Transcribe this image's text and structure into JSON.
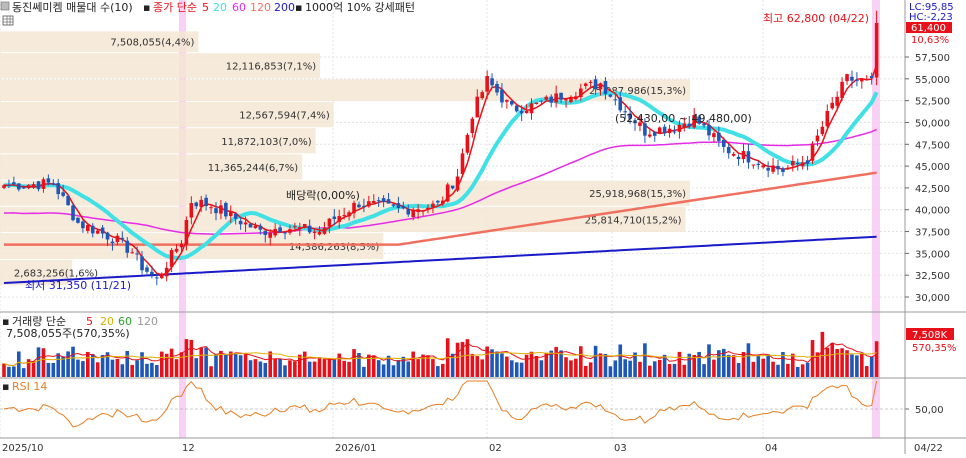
{
  "colors": {
    "up": "#e8111a",
    "down": "#1d58b8",
    "ma5": "#e8111a",
    "ma20": "#3fe0e6",
    "ma60": "#e62ce6",
    "ma120": "#f07060",
    "ma200": "#1a1ac8",
    "vol_ma5": "#e8111a",
    "vol_ma20": "#e0b000",
    "vol_ma60": "#2aa02a",
    "vol_ma120": "#999999",
    "volume_profile": "#f5e6d3",
    "highlight": "#f7c6f2",
    "rsi": "#e67e22"
  },
  "header": {
    "stock_name": "동진쎄미켐 매물대 수(10)",
    "ma_label": "종가 단순",
    "ma_periods": [
      "5",
      "20",
      "60",
      "120",
      "200"
    ],
    "extra": "1000억 10% 강세패턴"
  },
  "volume_header": {
    "label": "거래량 단순",
    "ma_periods": [
      "5",
      "20",
      "60",
      "120"
    ],
    "current": "7,508,055주(570,35%)"
  },
  "rsi_header": {
    "label": "RSI 14"
  },
  "right_labels": {
    "lc": "LC:95,85",
    "hc": "HC:-2,23",
    "last_price": "61,400",
    "change_pct": "10,63%",
    "last_volume": "7,508K",
    "volume_pct": "570,35%"
  },
  "annotations": {
    "high": "최고 62,800 (04/22)",
    "low": "최저 31,350 (11/21)",
    "dividend": "배당락(0,00%)",
    "range": "(52,430,00 ~ 49,480,00)"
  },
  "chart_data": {
    "type": "candlestick",
    "y_ticks": [
      "57,500",
      "55,000",
      "52,500",
      "50,000",
      "47,500",
      "45,000",
      "42,500",
      "40,000",
      "37,500",
      "35,000",
      "32,500",
      "30,000"
    ],
    "x_ticks": [
      "2025/10",
      "12",
      "2026/01",
      "02",
      "03",
      "04",
      "04/22"
    ],
    "rsi_ticks": [
      "50,00"
    ],
    "volume_profile": [
      {
        "label": "7,508,055(4,4%)",
        "low": 58000,
        "high": 60500
      },
      {
        "label": "12,116,853(7,1%)",
        "low": 55000,
        "high": 58000
      },
      {
        "label": "25,987,986(15,3%)",
        "low": 52400,
        "high": 55000
      },
      {
        "label": "12,567,594(7,4%)",
        "low": 49400,
        "high": 52400
      },
      {
        "label": "11,872,103(7,0%)",
        "low": 46400,
        "high": 49400
      },
      {
        "label": "11,365,244(6,7%)",
        "low": 43400,
        "high": 46400
      },
      {
        "label": "25,918,968(15,3%)",
        "low": 40400,
        "high": 43400
      },
      {
        "label": "25,814,710(15,2%)",
        "low": 37400,
        "high": 40400
      },
      {
        "label": "14,386,263(8,5%)",
        "low": 34300,
        "high": 37400
      },
      {
        "label": "2,683,256(1,6%)",
        "low": 31300,
        "high": 34300
      }
    ],
    "anchors": [
      [
        0,
        42800
      ],
      [
        10,
        43000
      ],
      [
        15,
        38500
      ],
      [
        22,
        36800
      ],
      [
        26,
        35200
      ],
      [
        28,
        33500
      ],
      [
        31,
        32000
      ],
      [
        33,
        33800
      ],
      [
        36,
        36500
      ],
      [
        38,
        41000
      ],
      [
        42,
        40500
      ],
      [
        47,
        39000
      ],
      [
        52,
        37500
      ],
      [
        56,
        38000
      ],
      [
        60,
        37800
      ],
      [
        64,
        37500
      ],
      [
        67,
        39000
      ],
      [
        72,
        40800
      ],
      [
        80,
        40000
      ],
      [
        88,
        40500
      ],
      [
        92,
        44000
      ],
      [
        95,
        51000
      ],
      [
        98,
        54800
      ],
      [
        103,
        51500
      ],
      [
        108,
        52000
      ],
      [
        115,
        53500
      ],
      [
        121,
        54500
      ],
      [
        125,
        52000
      ],
      [
        130,
        49000
      ],
      [
        136,
        49500
      ],
      [
        140,
        50500
      ],
      [
        146,
        47000
      ],
      [
        151,
        46000
      ],
      [
        158,
        44500
      ],
      [
        163,
        45800
      ],
      [
        166,
        49500
      ],
      [
        168,
        52000
      ],
      [
        171,
        55000
      ],
      [
        176,
        54500
      ],
      [
        177,
        61400
      ]
    ],
    "highs": {
      "177": 62800
    },
    "lows": {
      "31": 31350
    }
  }
}
